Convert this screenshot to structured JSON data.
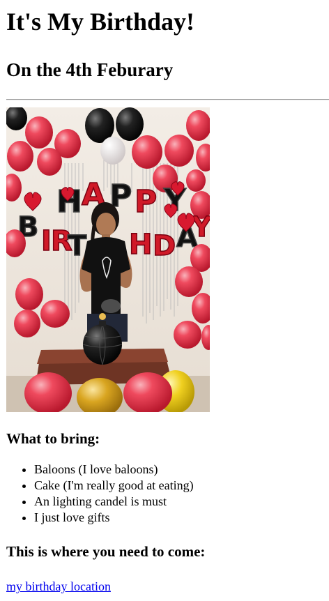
{
  "page": {
    "title": "It's My Birthday!",
    "subtitle": "On the 4th Feburary",
    "bring_heading": "What to bring:",
    "bring_items": [
      "Baloons (I love baloons)",
      "Cake (I'm really good at eating)",
      "An lighting candel is must",
      "I just love gifts"
    ],
    "where_heading": "This is where you need to come:",
    "location_link": "my birthday location"
  },
  "photo": {
    "banner_letters": [
      "H",
      "A",
      "P",
      "P",
      "Y",
      "B",
      "I",
      "R",
      "T",
      "H",
      "D",
      "A",
      "Y"
    ]
  },
  "colors": {
    "link": "#0000ee",
    "balloon_red": "#e2293f",
    "balloon_black": "#1a1a1a",
    "balloon_gold": "#d9a520",
    "balloon_yellow": "#f0d020",
    "wall": "#efe8e1"
  }
}
